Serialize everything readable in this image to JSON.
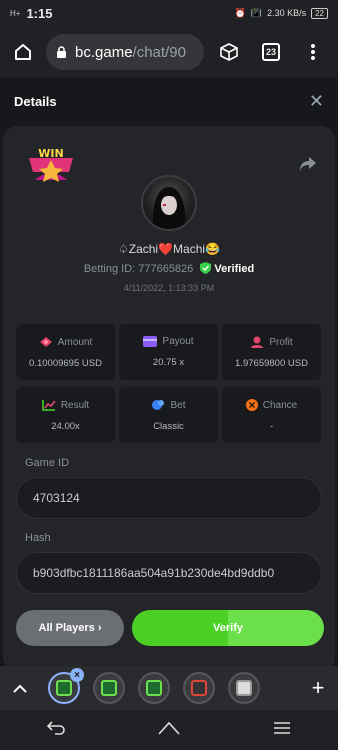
{
  "status": {
    "signal": "H+",
    "time": "1:15",
    "net_speed": "2.30 KB/s",
    "battery": "22"
  },
  "browser": {
    "domain": "bc.game",
    "path": "/chat/90",
    "tab_count": "23"
  },
  "dialog": {
    "title": "Details",
    "badge_text": "WIN"
  },
  "user": {
    "name": "♤Zachi❤️Machi😂",
    "betting_label": "Betting ID: 777665826",
    "verified_label": "Verified",
    "date": "4/11/2022, 1:13:33 PM"
  },
  "stats": [
    {
      "label": "Amount",
      "value": "0.10009695 USD",
      "icon": "amount-icon"
    },
    {
      "label": "Payout",
      "value": "20.75 x",
      "icon": "payout-icon"
    },
    {
      "label": "Profit",
      "value": "1.97659800 USD",
      "icon": "profit-icon"
    },
    {
      "label": "Result",
      "value": "24.00x",
      "icon": "result-icon"
    },
    {
      "label": "Bet",
      "value": "Classic",
      "icon": "bet-icon"
    },
    {
      "label": "Chance",
      "value": "-",
      "icon": "chance-icon"
    }
  ],
  "game": {
    "id_label": "Game ID",
    "id_value": "4703124",
    "hash_label": "Hash",
    "hash_value": "b903dfbc1811186aa504a91b230de4bd9ddb0"
  },
  "buttons": {
    "all_players": "All Players ›",
    "verify": "Verify"
  },
  "colors": {
    "accent_green": "#4bd126",
    "verified_green": "#3ad14a",
    "bg": "#17181b",
    "panel": "#232528"
  }
}
